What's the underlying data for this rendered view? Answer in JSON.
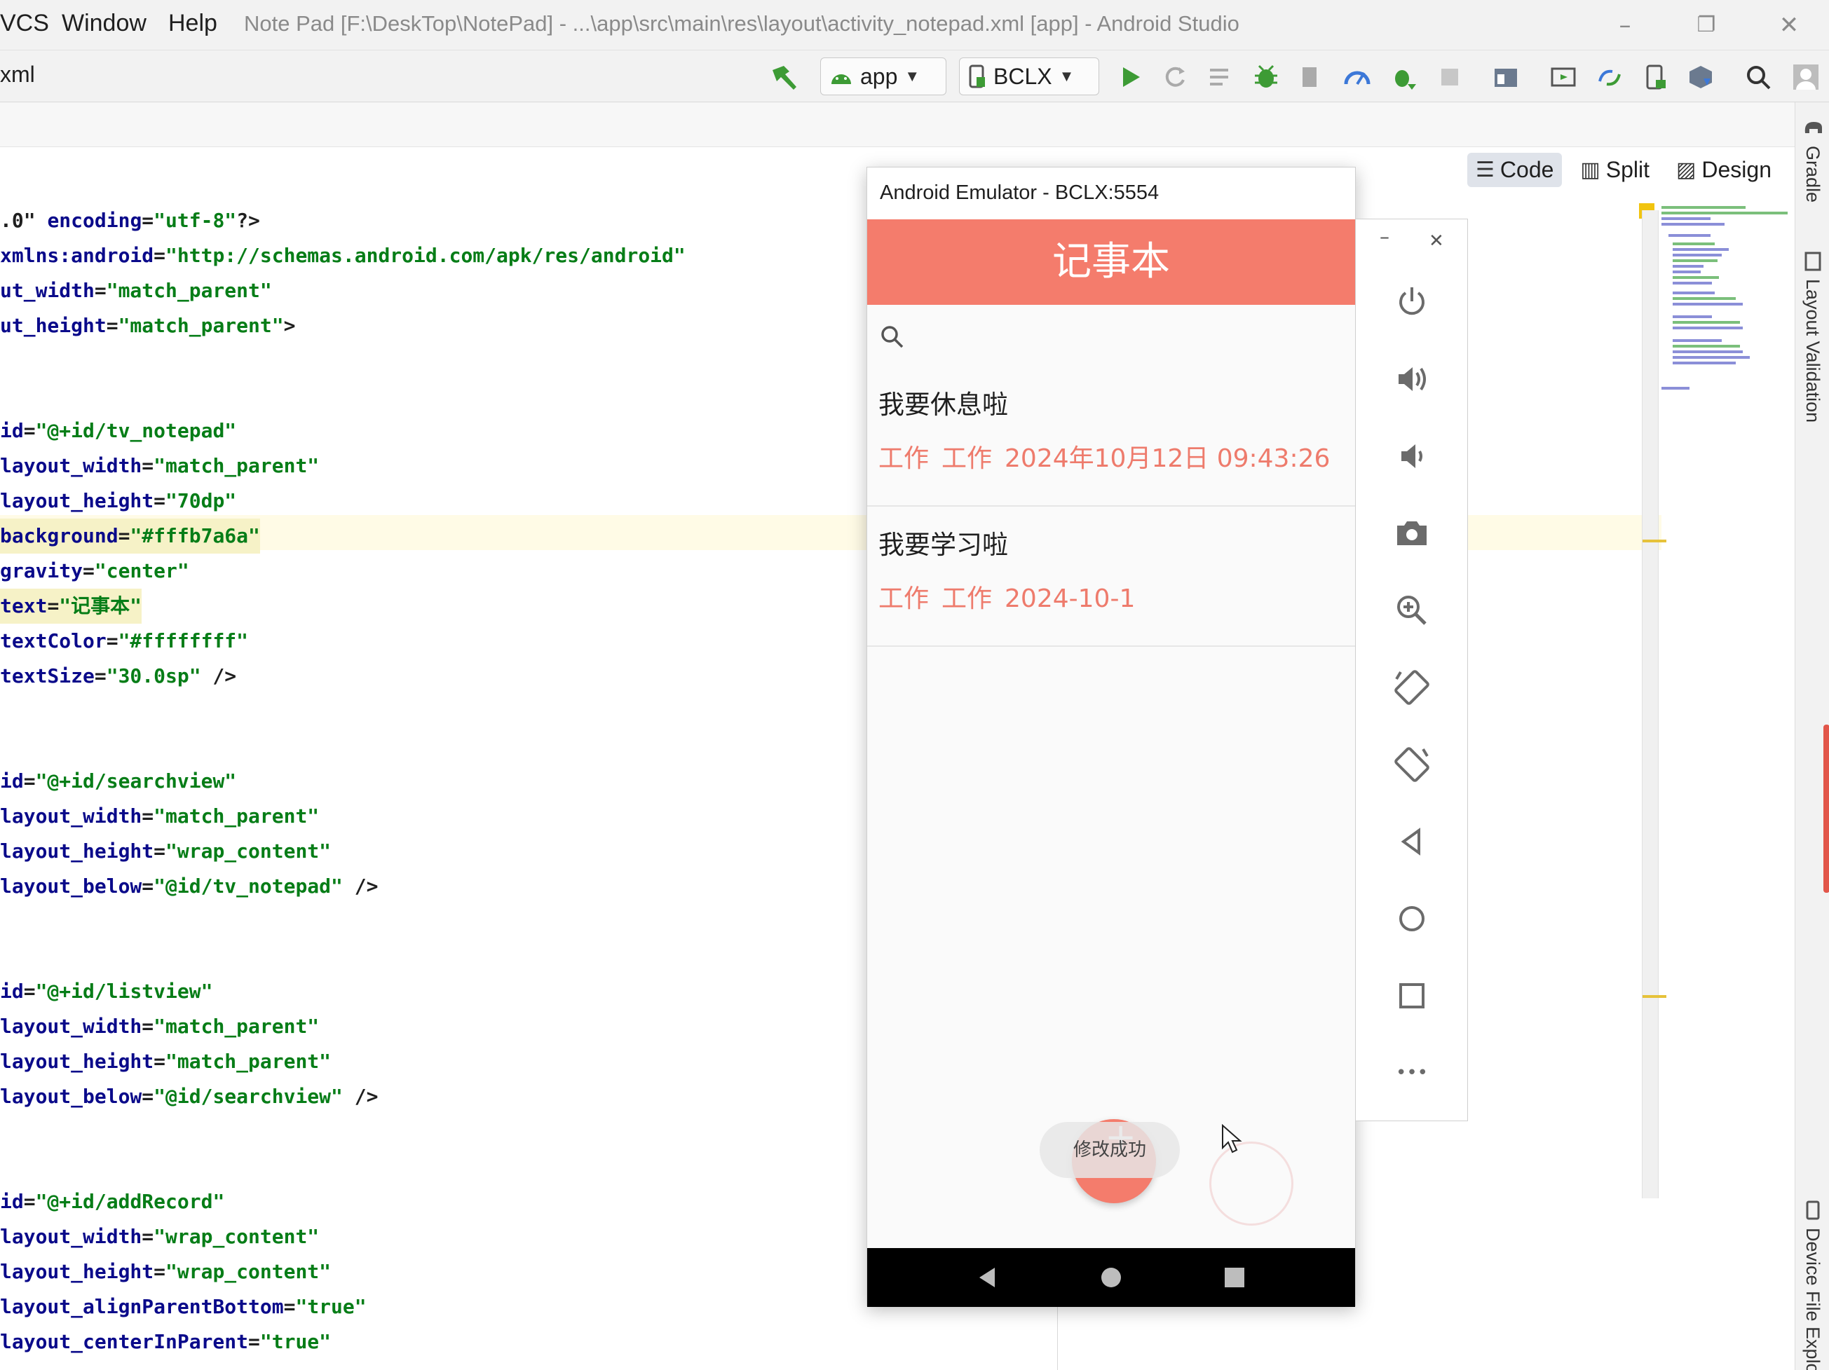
{
  "menu": {
    "items": [
      "VCS",
      "Window",
      "Help"
    ]
  },
  "window_title": "Note Pad [F:\\DeskTop\\NotePad] - ...\\app\\src\\main\\res\\layout\\activity_notepad.xml [app] - Android Studio",
  "window_controls": {
    "minimize": "–",
    "restore": "❐",
    "close": "✕"
  },
  "toolbar": {
    "breadcrumb": "xml",
    "run_config": "app",
    "device": "BCLX"
  },
  "view_tabs": [
    "Code",
    "Split",
    "Design"
  ],
  "side_tool_windows": [
    "Gradle",
    "Layout Validation",
    "Device File Explo"
  ],
  "code_lines": [
    [
      {
        "c": "p",
        "t": ".0\" "
      },
      {
        "c": "k",
        "t": "encoding"
      },
      {
        "c": "p",
        "t": "="
      },
      {
        "c": "s",
        "t": "\"utf-8\""
      },
      {
        "c": "p",
        "t": "?>"
      }
    ],
    [
      {
        "c": "k",
        "t": "xmlns:android"
      },
      {
        "c": "p",
        "t": "="
      },
      {
        "c": "s",
        "t": "\"http://schemas.android.com/apk/res/android\""
      }
    ],
    [
      {
        "c": "k",
        "t": "ut_width"
      },
      {
        "c": "p",
        "t": "="
      },
      {
        "c": "s",
        "t": "\"match_parent\""
      }
    ],
    [
      {
        "c": "k",
        "t": "ut_height"
      },
      {
        "c": "p",
        "t": "="
      },
      {
        "c": "s",
        "t": "\"match_parent\""
      },
      {
        "c": "p",
        "t": ">"
      }
    ],
    [],
    [],
    [
      {
        "c": "k",
        "t": "id"
      },
      {
        "c": "p",
        "t": "="
      },
      {
        "c": "s",
        "t": "\"@+id/tv_notepad\""
      }
    ],
    [
      {
        "c": "k",
        "t": "layout_width"
      },
      {
        "c": "p",
        "t": "="
      },
      {
        "c": "s",
        "t": "\"match_parent\""
      }
    ],
    [
      {
        "c": "k",
        "t": "layout_height"
      },
      {
        "c": "p",
        "t": "="
      },
      {
        "c": "s",
        "t": "\"70dp\""
      }
    ],
    [
      {
        "c": "k",
        "t": "background"
      },
      {
        "c": "p",
        "t": "="
      },
      {
        "c": "s",
        "t": "\"#fffb7a6a\""
      }
    ],
    [
      {
        "c": "k",
        "t": "gravity"
      },
      {
        "c": "p",
        "t": "="
      },
      {
        "c": "s",
        "t": "\"center\""
      }
    ],
    [
      {
        "c": "k",
        "t": "text"
      },
      {
        "c": "p",
        "t": "="
      },
      {
        "c": "s",
        "t": "\"记事本\""
      }
    ],
    [
      {
        "c": "k",
        "t": "textColor"
      },
      {
        "c": "p",
        "t": "="
      },
      {
        "c": "s",
        "t": "\"#ffffffff\""
      }
    ],
    [
      {
        "c": "k",
        "t": "textSize"
      },
      {
        "c": "p",
        "t": "="
      },
      {
        "c": "s",
        "t": "\"30.0sp\""
      },
      {
        "c": "p",
        "t": " />"
      }
    ],
    [],
    [],
    [
      {
        "c": "k",
        "t": "id"
      },
      {
        "c": "p",
        "t": "="
      },
      {
        "c": "s",
        "t": "\"@+id/searchview\""
      }
    ],
    [
      {
        "c": "k",
        "t": "layout_width"
      },
      {
        "c": "p",
        "t": "="
      },
      {
        "c": "s",
        "t": "\"match_parent\""
      }
    ],
    [
      {
        "c": "k",
        "t": "layout_height"
      },
      {
        "c": "p",
        "t": "="
      },
      {
        "c": "s",
        "t": "\"wrap_content\""
      }
    ],
    [
      {
        "c": "k",
        "t": "layout_below"
      },
      {
        "c": "p",
        "t": "="
      },
      {
        "c": "s",
        "t": "\"@id/tv_notepad\""
      },
      {
        "c": "p",
        "t": " />"
      }
    ],
    [],
    [],
    [
      {
        "c": "k",
        "t": "id"
      },
      {
        "c": "p",
        "t": "="
      },
      {
        "c": "s",
        "t": "\"@+id/listview\""
      }
    ],
    [
      {
        "c": "k",
        "t": "layout_width"
      },
      {
        "c": "p",
        "t": "="
      },
      {
        "c": "s",
        "t": "\"match_parent\""
      }
    ],
    [
      {
        "c": "k",
        "t": "layout_height"
      },
      {
        "c": "p",
        "t": "="
      },
      {
        "c": "s",
        "t": "\"match_parent\""
      }
    ],
    [
      {
        "c": "k",
        "t": "layout_below"
      },
      {
        "c": "p",
        "t": "="
      },
      {
        "c": "s",
        "t": "\"@id/searchview\""
      },
      {
        "c": "p",
        "t": " />"
      }
    ],
    [],
    [],
    [
      {
        "c": "k",
        "t": "id"
      },
      {
        "c": "p",
        "t": "="
      },
      {
        "c": "s",
        "t": "\"@+id/addRecord\""
      }
    ],
    [
      {
        "c": "k",
        "t": "layout_width"
      },
      {
        "c": "p",
        "t": "="
      },
      {
        "c": "s",
        "t": "\"wrap_content\""
      }
    ],
    [
      {
        "c": "k",
        "t": "layout_height"
      },
      {
        "c": "p",
        "t": "="
      },
      {
        "c": "s",
        "t": "\"wrap_content\""
      }
    ],
    [
      {
        "c": "k",
        "t": "layout_alignParentBottom"
      },
      {
        "c": "p",
        "t": "="
      },
      {
        "c": "s",
        "t": "\"true\""
      }
    ],
    [
      {
        "c": "k",
        "t": "layout_centerInParent"
      },
      {
        "c": "p",
        "t": "="
      },
      {
        "c": "s",
        "t": "\"true\""
      }
    ]
  ],
  "emulator": {
    "title": "Android Emulator - BCLX:5554",
    "app_title": "记事本",
    "notes": [
      {
        "title": "我要休息啦",
        "type": "工作",
        "category": "工作",
        "date": "2024年10月12日 09:43:26"
      },
      {
        "title": "我要学习啦",
        "type": "工作",
        "category": "工作",
        "date": "2024-10-1"
      }
    ],
    "toast": "修改成功",
    "fab_label": "+",
    "side_panel": {
      "minimize": "–",
      "close": "✕",
      "buttons": [
        "power-icon",
        "volume-up-icon",
        "volume-down-icon",
        "camera-icon",
        "zoom-icon",
        "rotate-left-icon",
        "rotate-right-icon",
        "back-icon",
        "home-icon",
        "overview-icon",
        "more-icon"
      ],
      "more_label": "•••"
    }
  },
  "colors": {
    "accent": "#f47c6c",
    "note_meta": "#ee7b6c",
    "code_attr": "#0a0a8a",
    "code_string": "#067d17",
    "run_green": "#3d9b35"
  }
}
